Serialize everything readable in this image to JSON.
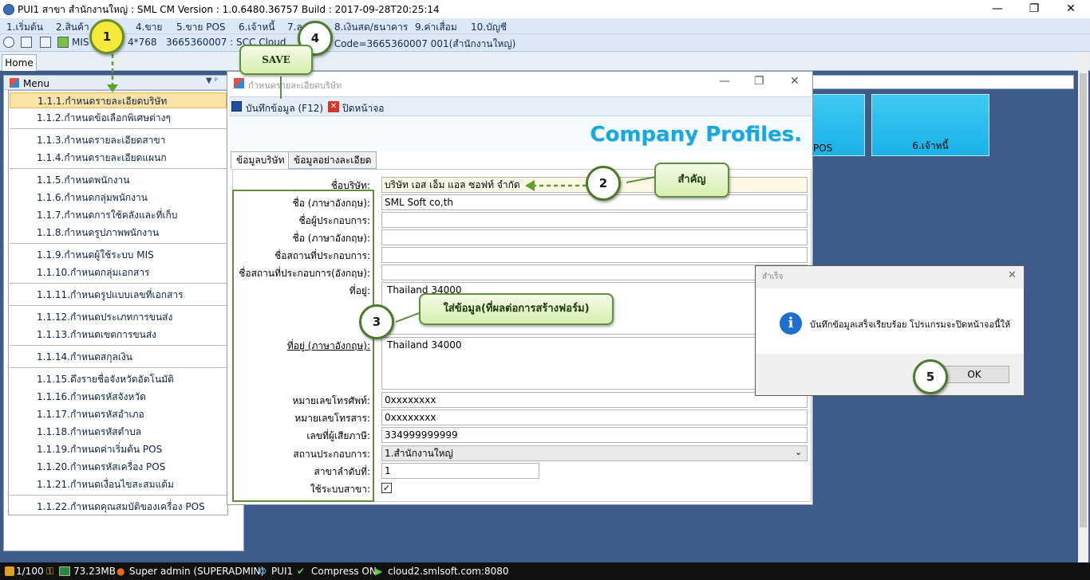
{
  "window": {
    "title": "PUI1 สาขา สำนักงานใหญ่ : SML CM Version : 1.0.6480.36757  Build : 2017-09-28T20:25:14",
    "minimize": "—",
    "restore": "❐",
    "close": "✕"
  },
  "menubar": [
    "1.เริ่มต้น",
    "2.สินค้า",
    "4.ขาย",
    "5.ขาย POS",
    "6.เจ้าหนี้",
    "7.ล",
    "8.เงินสด/ธนาคาร",
    "9.ค่าเสื่อม",
    "10.บัญชี"
  ],
  "toolbar": {
    "mis": "MIS",
    "resolution": "4*768",
    "info": "3665360007 : SCC Cloud",
    "code": "r Code=3665360007 001(สำนักงานใหญ่)"
  },
  "tabs": {
    "home": "Home"
  },
  "left_menu": {
    "header": "Menu",
    "pin": "▼ ᵖ",
    "items": [
      "1.1.1.กำหนดรายละเอียดบริษัท",
      "1.1.2.กำหนดข้อเลือกพิเศษต่างๆ",
      "1.1.3.กำหนดรายละเอียดสาขา",
      "1.1.4.กำหนดรายละเอียดแผนก",
      "1.1.5.กำหนดพนักงาน",
      "1.1.6.กำหนดกลุ่มพนักงาน",
      "1.1.7.กำหนดการใช้คลังและที่เก็บ",
      "1.1.8.กำหนดรูปภาพพนักงาน",
      "1.1.9.กำหนดผู้ใช้ระบบ MIS",
      "1.1.10.กำหนดกลุ่มเอกสาร",
      "1.1.11.กำหนดรูปแบบเลขที่เอกสาร",
      "1.1.12.กำหนดประเภทการขนส่ง",
      "1.1.13.กำหนดเขตการขนส่ง",
      "1.1.14.กำหนดสกุลเงิน",
      "1.1.15.ดึงรายชื่อจังหวัดอัตโนมัติ",
      "1.1.16.กำหนดรหัสจังหวัด",
      "1.1.17.กำหนดรหัสอำเภอ",
      "1.1.18.กำหนดรหัสตำบล",
      "1.1.19.กำหนดค่าเริ่มต้น POS",
      "1.1.20.กำหนดรหัสเครื่อง POS",
      "1.1.21.กำหนดเงื่อนไขสะสมแต้ม",
      "1.1.22.กำหนดคุณสมบัติของเครื่อง POS"
    ]
  },
  "tiles": [
    "POS",
    "6.เจ้าหนี้"
  ],
  "dialog": {
    "title": "กำหนดรายละเอียดบริษัท",
    "save_button": "บันทึกข้อมูล (F12)",
    "close_button": "ปิดหน้าจอ",
    "banner": "Company Profiles.",
    "tab1": "ข้อมูลบริษัท",
    "tab2": "ข้อมูลอย่างละเอียด",
    "labels": {
      "company_name": "ชื่อบริษัท:",
      "name_en": "ชื่อ (ภาษาอังกฤษ):",
      "operator_name": "ชื่อผู้ประกอบการ:",
      "operator_name_en": "ชื่อ (ภาษาอังกฤษ):",
      "place_name": "ชื่อสถานที่ประกอบการ:",
      "place_name_en": "ชื่อสถานที่ประกอบการ(อังกฤษ):",
      "address": "ที่อยู่:",
      "address_en": "ที่อยู่ (ภาษาอังกฤษ):",
      "phone": "หมายเลขโทรศัพท์:",
      "fax": "หมายเลขโทรสาร:",
      "tax_id": "เลขที่ผู้เสียภาษี:",
      "establishment": "สถานประกอบการ:",
      "branch_no": "สาขาลำดับที่:",
      "use_branch": "ใช้ระบบสาขา:"
    },
    "values": {
      "company_name": "บริษัท เอส เอ็ม แอล ซอฟท์ จำกัด",
      "name_en": "SML Soft co,th",
      "operator_name": "",
      "operator_name_en": "",
      "place_name": "",
      "place_name_en": "",
      "address": "Thailand  34000",
      "address_en": "Thailand  34000",
      "phone": "0xxxxxxxx",
      "fax": "0xxxxxxxx",
      "tax_id": "334999999999",
      "establishment": "1.สำนักงานใหญ่",
      "branch_no": "1",
      "use_branch_check": "✓"
    }
  },
  "popup": {
    "title": "สำเร็จ",
    "close": "✕",
    "icon": "i",
    "message": "บันทึกข้อมูลเสร็จเรียบร้อย โปรแกรมจะปิดหน้าจอนี้ให้",
    "ok": "OK"
  },
  "statusbar": {
    "page": "1/100",
    "memory": "73.23MB",
    "user": "Super admin (SUPERADMIN)",
    "branch": "PUI1",
    "compress": "Compress ON",
    "server": "cloud2.smlsoft.com:8080"
  },
  "annotations": {
    "n1": "1",
    "n2": "2",
    "n3": "3",
    "n4": "4",
    "n5": "5",
    "save": "SAVE",
    "important": "สำคัญ",
    "fill_info": "ใส่ข้อมูล(ที่ผลต่อการสร้างฟอร์ม)"
  }
}
